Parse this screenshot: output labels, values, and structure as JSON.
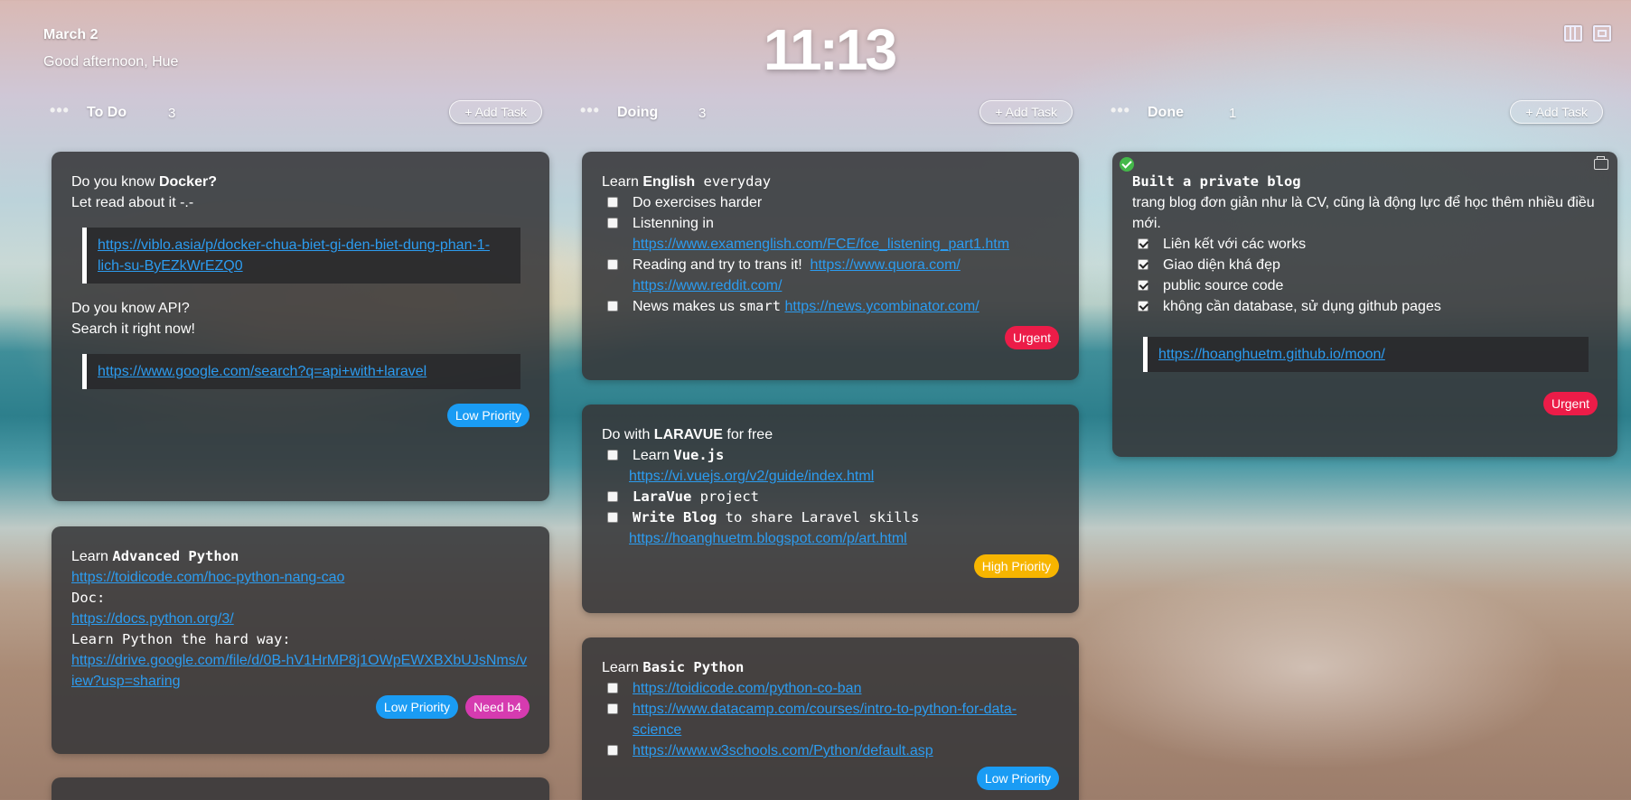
{
  "header": {
    "date": "March 2",
    "greeting": "Good afternoon, Hue",
    "clock": "11:13"
  },
  "columns": [
    {
      "menu": "•••",
      "title": "To Do",
      "count": "3",
      "add_label": "+ Add Task",
      "cards": [
        {
          "line1_pre": "Do you know ",
          "line1_bold": "Docker?",
          "line2": "Let read about it -.-",
          "quote1_link": "https://viblo.asia/p/docker-chua-biet-gi-den-biet-dung-phan-1-lich-su-ByEZkWrEZQ0",
          "line3": "Do you know API?",
          "line4": "Search it right now!",
          "quote2_link": "https://www.google.com/search?q=api+with+laravel",
          "tags": [
            "Low Priority"
          ]
        },
        {
          "line1_pre": "Learn ",
          "line1_bold": "Advanced Python",
          "link1": "https://toidicode.com/hoc-python-nang-cao",
          "doc_label": "Doc:",
          "link2": "https://docs.python.org/3/",
          "hard_way": "Learn Python the hard way:",
          "link3": "https://drive.google.com/file/d/0B-hV1HrMP8j1OWpEWXBXbUJsNms/view?usp=sharing",
          "tags": [
            "Low Priority",
            "Need b4"
          ]
        }
      ]
    },
    {
      "menu": "•••",
      "title": "Doing",
      "count": "3",
      "add_label": "+ Add Task",
      "cards": [
        {
          "title_pre": "Learn ",
          "title_bold": "English",
          "title_post": " everyday",
          "items": [
            {
              "text": "Do exercises harder"
            },
            {
              "text": "Listenning in",
              "link": "https://www.examenglish.com/FCE/fce_listening_part1.htm"
            },
            {
              "text": "Reading and try to trans it!",
              "link": "https://www.quora.com/",
              "link2": "https://www.reddit.com/"
            },
            {
              "text_pre": "News makes us ",
              "text_mono": "smart",
              "link": "https://news.ycombinator.com/"
            }
          ],
          "tags": [
            "Urgent"
          ]
        },
        {
          "title_pre": "Do with ",
          "title_bold": "LARAVUE",
          "title_post": " for free",
          "items": [
            {
              "text": "Learn ",
              "mono_bold": "Vue.js",
              "link": "https://vi.vuejs.org/v2/guide/index.html"
            },
            {
              "mono_bold": "LaraVue",
              "mono": " project"
            },
            {
              "mono_bold": "Write Blog",
              "mono": " to share Laravel skills",
              "link": "https://hoanghuetm.blogspot.com/p/art.html"
            }
          ],
          "tags": [
            "High Priority"
          ]
        },
        {
          "title_pre": "Learn ",
          "title_bold": "Basic Python",
          "items": [
            {
              "link": "https://toidicode.com/python-co-ban"
            },
            {
              "link": "https://www.datacamp.com/courses/intro-to-python-for-data-science"
            },
            {
              "link": "https://www.w3schools.com/Python/default.asp"
            }
          ],
          "tags": [
            "Low Priority"
          ]
        }
      ]
    },
    {
      "menu": "•••",
      "title": "Done",
      "count": "1",
      "add_label": "+ Add Task",
      "cards": [
        {
          "title": "Built a private blog",
          "desc": "trang blog đơn giản như là CV, cũng là động lực để học thêm nhiều điều mới.",
          "items": [
            {
              "text": "Liên kết với các works"
            },
            {
              "text": "Giao diện khá đẹp"
            },
            {
              "text": "public source code"
            },
            {
              "text": "không cần database, sử dụng github pages"
            }
          ],
          "quote_link": "https://hoanghuetm.github.io/moon/",
          "tags": [
            "Urgent"
          ]
        }
      ]
    }
  ]
}
